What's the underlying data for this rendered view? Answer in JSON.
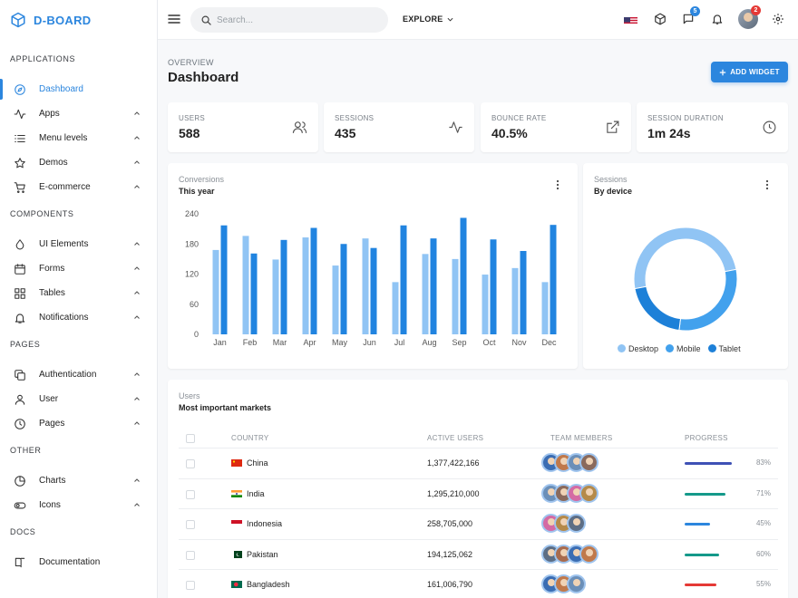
{
  "brand": {
    "name": "D-BOARD"
  },
  "sidebar": {
    "sections": [
      {
        "title": "APPLICATIONS",
        "items": [
          {
            "label": "Dashboard",
            "icon": "compass-icon",
            "active": true,
            "chevron": false
          },
          {
            "label": "Apps",
            "icon": "activity-icon",
            "chevron": true
          },
          {
            "label": "Menu levels",
            "icon": "list-icon",
            "chevron": true
          },
          {
            "label": "Demos",
            "icon": "star-icon",
            "chevron": true
          },
          {
            "label": "E-commerce",
            "icon": "cart-icon",
            "chevron": true
          }
        ]
      },
      {
        "title": "COMPONENTS",
        "items": [
          {
            "label": "UI Elements",
            "icon": "droplet-icon",
            "chevron": true
          },
          {
            "label": "Forms",
            "icon": "calendar-icon",
            "chevron": true
          },
          {
            "label": "Tables",
            "icon": "grid-icon",
            "chevron": true
          },
          {
            "label": "Notifications",
            "icon": "bell-icon",
            "chevron": true
          }
        ]
      },
      {
        "title": "PAGES",
        "items": [
          {
            "label": "Authentication",
            "icon": "copy-icon",
            "chevron": true
          },
          {
            "label": "User",
            "icon": "user-icon",
            "chevron": true
          },
          {
            "label": "Pages",
            "icon": "clock-icon",
            "chevron": true
          }
        ]
      },
      {
        "title": "OTHER",
        "items": [
          {
            "label": "Charts",
            "icon": "pie-chart-icon",
            "chevron": true
          },
          {
            "label": "Icons",
            "icon": "toggle-icon",
            "chevron": true
          }
        ]
      },
      {
        "title": "DOCS",
        "items": [
          {
            "label": "Documentation",
            "icon": "book-icon",
            "chevron": false
          }
        ]
      }
    ]
  },
  "topbar": {
    "search_placeholder": "Search...",
    "explore_label": "EXPLORE",
    "messages_badge": "5",
    "avatar_badge": "2"
  },
  "header": {
    "overline": "OVERVIEW",
    "title": "Dashboard",
    "add_widget_label": "ADD WIDGET"
  },
  "stats": [
    {
      "label": "USERS",
      "value": "588",
      "icon": "users-icon"
    },
    {
      "label": "SESSIONS",
      "value": "435",
      "icon": "activity-icon"
    },
    {
      "label": "BOUNCE RATE",
      "value": "40.5%",
      "icon": "external-link-icon"
    },
    {
      "label": "SESSION DURATION",
      "value": "1m 24s",
      "icon": "clock-icon"
    }
  ],
  "conversions": {
    "subtitle": "Conversions",
    "title": "This year"
  },
  "sessions_card": {
    "subtitle": "Sessions",
    "title": "By device"
  },
  "chart_data": [
    {
      "type": "bar",
      "categories": [
        "Jan",
        "Feb",
        "Mar",
        "Apr",
        "May",
        "Jun",
        "Jul",
        "Aug",
        "Sep",
        "Oct",
        "Nov",
        "Dec"
      ],
      "series": [
        {
          "values": [
            168,
            196,
            149,
            193,
            137,
            191,
            104,
            160,
            150,
            119,
            132,
            104
          ],
          "color": "#90c4f4"
        },
        {
          "values": [
            217,
            161,
            188,
            212,
            180,
            172,
            217,
            191,
            232,
            189,
            166,
            218
          ],
          "color": "#2184e0"
        }
      ],
      "yticks": [
        0,
        60,
        120,
        180,
        240
      ],
      "ylim": [
        0,
        240
      ],
      "legend": "none",
      "grid": false
    },
    {
      "type": "pie",
      "donut": true,
      "series": [
        {
          "name": "Desktop",
          "value": 50,
          "color": "#90c4f4"
        },
        {
          "name": "Mobile",
          "value": 30,
          "color": "#42a1ed"
        },
        {
          "name": "Tablet",
          "value": 20,
          "color": "#1d80d8"
        }
      ],
      "legend": "bottom"
    }
  ],
  "markets": {
    "subtitle": "Users",
    "title": "Most important markets",
    "columns": [
      "COUNTRY",
      "ACTIVE USERS",
      "TEAM MEMBERS",
      "PROGRESS"
    ],
    "rows": [
      {
        "country": "China",
        "flag": "cn",
        "users": "1,377,422,166",
        "members": 4,
        "progress": 83,
        "progress_label": "83%",
        "color": "#3f51b5"
      },
      {
        "country": "India",
        "flag": "in",
        "users": "1,295,210,000",
        "members": 4,
        "progress": 71,
        "progress_label": "71%",
        "color": "#14998a"
      },
      {
        "country": "Indonesia",
        "flag": "id",
        "users": "258,705,000",
        "members": 3,
        "progress": 45,
        "progress_label": "45%",
        "color": "#2c86de"
      },
      {
        "country": "Pakistan",
        "flag": "pk",
        "users": "194,125,062",
        "members": 4,
        "progress": 60,
        "progress_label": "60%",
        "color": "#14998a"
      },
      {
        "country": "Bangladesh",
        "flag": "bd",
        "users": "161,006,790",
        "members": 3,
        "progress": 55,
        "progress_label": "55%",
        "color": "#e53935"
      }
    ]
  },
  "colors": {
    "accent": "#2c86de",
    "badge_blue": "#2c86de",
    "badge_red": "#e53935"
  }
}
